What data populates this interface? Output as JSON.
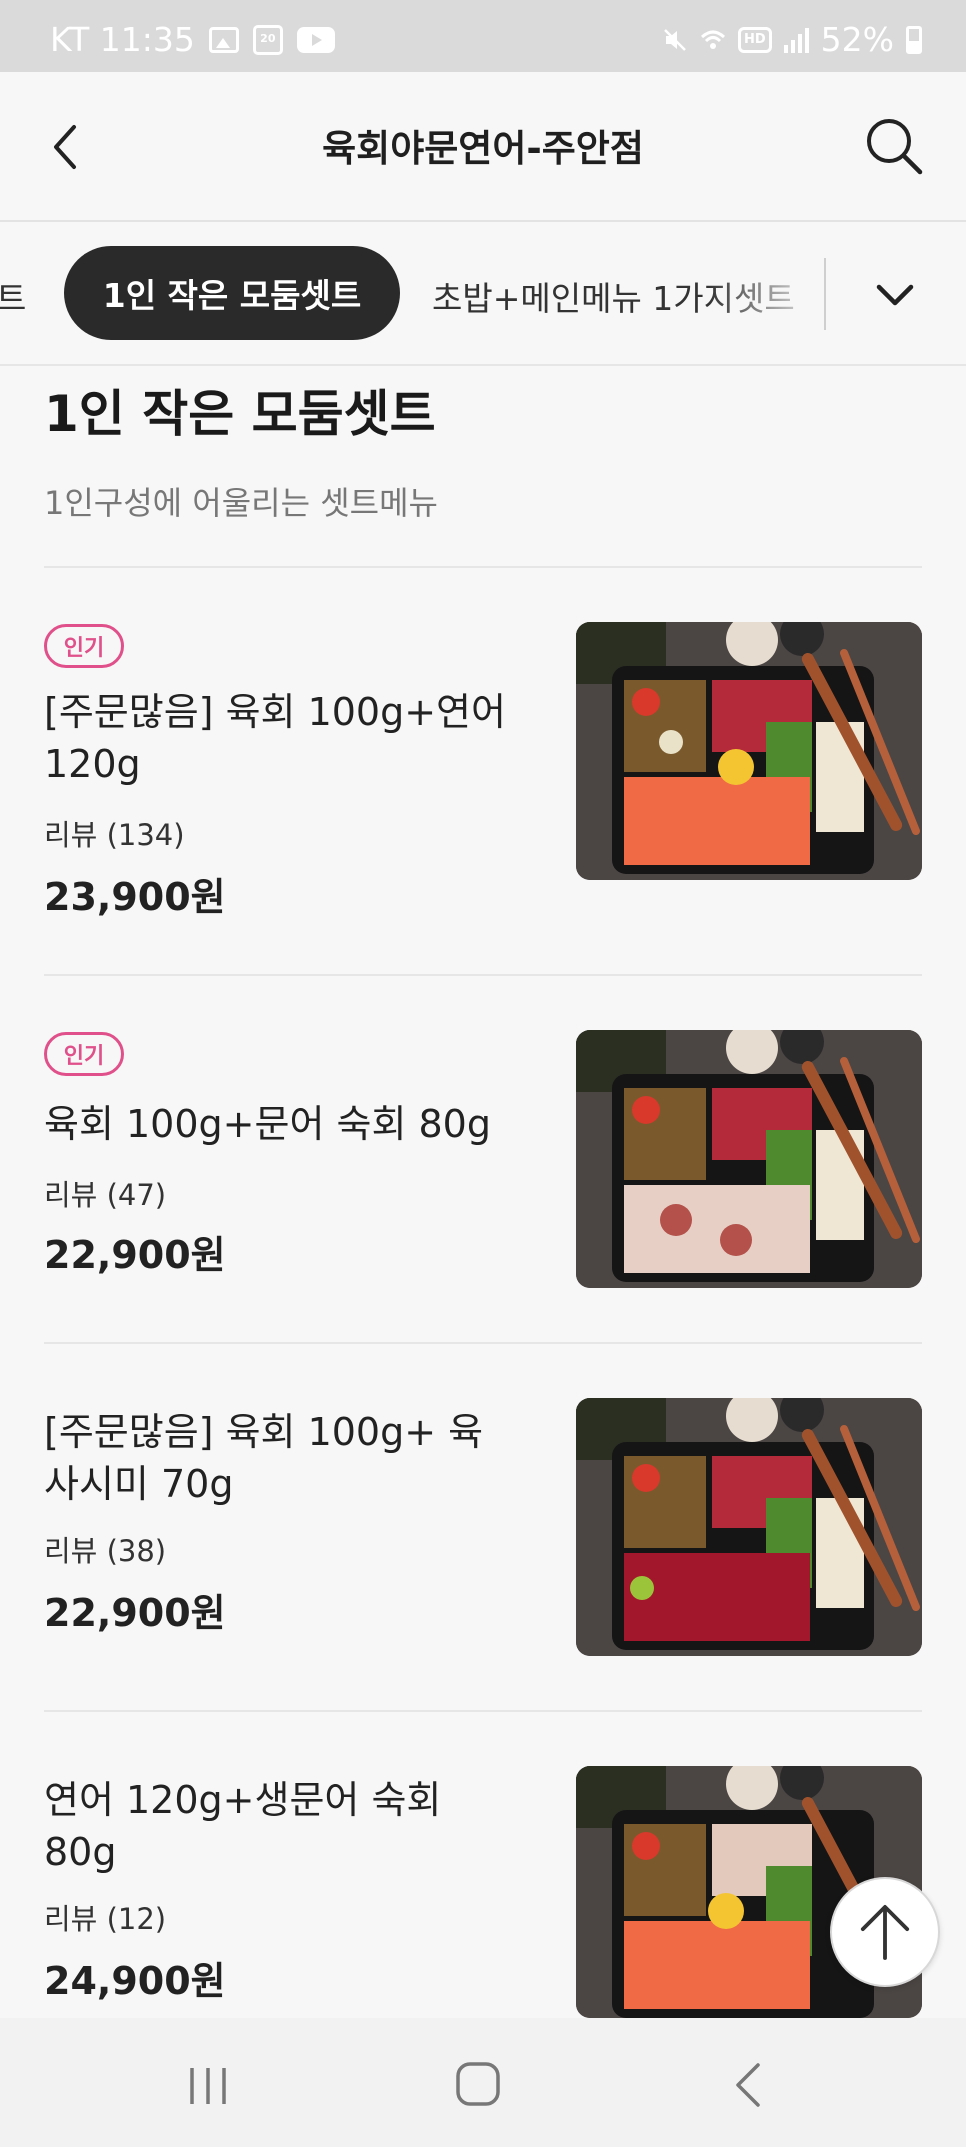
{
  "status_bar": {
    "carrier_time": "KT 11:35",
    "battery": "52%",
    "hd_label": "HD",
    "badge_20": "20"
  },
  "header": {
    "title": "육회야문연어-주안점"
  },
  "tabs": {
    "prev_partial": "트",
    "active": "1인 작은 모둠셋트",
    "next": "초밥+메인메뉴 1가지셋트"
  },
  "section": {
    "title": "1인 작은 모둠셋트",
    "description": "1인구성에 어울리는 셋트메뉴"
  },
  "items": [
    {
      "badge": "인기",
      "name": "[주문많음] 육회 100g+연어 120g",
      "review": "리뷰 (134)",
      "price": "23,900원"
    },
    {
      "badge": "인기",
      "name": "육회 100g+문어 숙회 80g",
      "review": "리뷰 (47)",
      "price": "22,900원"
    },
    {
      "badge": "",
      "name": "[주문많음] 육회 100g+ 육사시미 70g",
      "review": "리뷰 (38)",
      "price": "22,900원"
    },
    {
      "badge": "",
      "name": "연어 120g+생문어 숙회 80g",
      "review": "리뷰 (12)",
      "price": "24,900원"
    }
  ],
  "colors": {
    "accent_pink": "#e0508a",
    "active_tab": "#2a2a2a",
    "background": "#f7f7f7"
  },
  "icons": [
    "back-arrow-icon",
    "search-icon",
    "chevron-down-icon",
    "arrow-up-icon",
    "recents-icon",
    "home-icon",
    "nav-back-icon"
  ]
}
